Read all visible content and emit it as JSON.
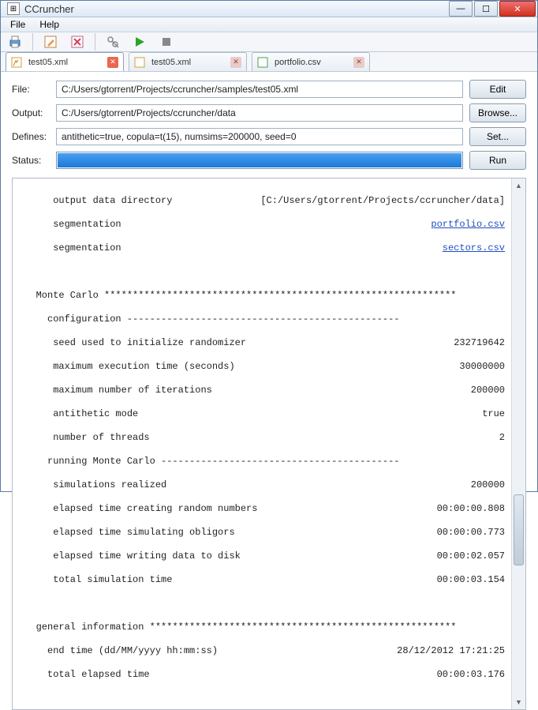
{
  "title": "CCruncher",
  "menu": {
    "file": "File",
    "help": "Help"
  },
  "tabs": [
    {
      "label": "test05.xml",
      "active": true
    },
    {
      "label": "test05.xml",
      "active": false
    },
    {
      "label": "portfolio.csv",
      "active": false
    }
  ],
  "form": {
    "file_label": "File:",
    "file_value": "C:/Users/gtorrent/Projects/ccruncher/samples/test05.xml",
    "edit_btn": "Edit",
    "output_label": "Output:",
    "output_value": "C:/Users/gtorrent/Projects/ccruncher/data",
    "browse_btn": "Browse...",
    "defines_label": "Defines:",
    "defines_value": "antithetic=true, copula=t(15), numsims=200000, seed=0",
    "set_btn": "Set...",
    "status_label": "Status:",
    "run_btn": "Run"
  },
  "out": {
    "l1k": "      output data directory",
    "l1v": "[C:/Users/gtorrent/Projects/ccruncher/data]",
    "l2k": "      segmentation",
    "l2v": "portfolio.csv",
    "l3k": "      segmentation",
    "l3v": "sectors.csv",
    "mc_hdr": "   Monte Carlo ",
    "cfg": "     configuration ------------------------------------------------",
    "seedk": "      seed used to initialize randomizer",
    "seedv": "232719642",
    "maxtk": "      maximum execution time (seconds)",
    "maxtv": "30000000",
    "maxik": "      maximum number of iterations",
    "maxiv": "200000",
    "antik": "      antithetic mode",
    "antiv": "true",
    "thrdk": "      number of threads",
    "thrdv": "2",
    "runmc": "     running Monte Carlo ------------------------------------------",
    "simk": "      simulations realized",
    "simv": "200000",
    "rndk": "      elapsed time creating random numbers",
    "rndv": "00:00:00.808",
    "oblk": "      elapsed time simulating obligors",
    "oblv": "00:00:00.773",
    "wrtk": "      elapsed time writing data to disk",
    "wrtv": "00:00:02.057",
    "totk": "      total simulation time",
    "totv": "00:00:03.154",
    "genhdr": "   general information ",
    "endk": "     end time (dd/MM/yyyy hh:mm:ss)",
    "endv": "28/12/2012 17:21:25",
    "tek": "     total elapsed time",
    "tev": "00:00:03.176"
  }
}
